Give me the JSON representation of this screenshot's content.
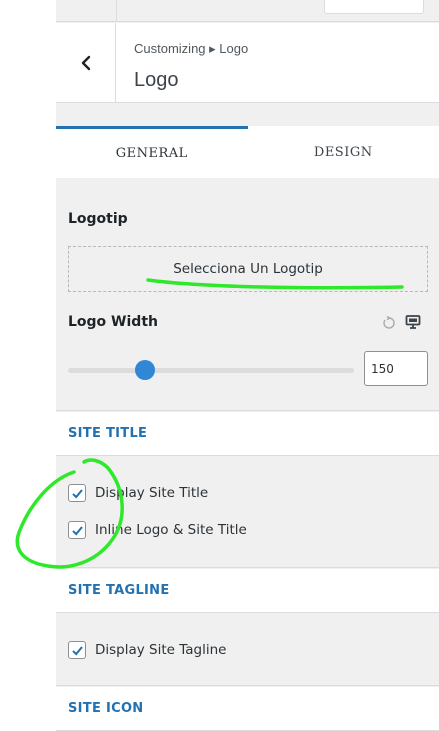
{
  "header": {
    "breadcrumb": "Customizing ▸ Logo",
    "title": "Logo"
  },
  "tabs": [
    {
      "label": "GENERAL",
      "active": true
    },
    {
      "label": "DESIGN",
      "active": false
    }
  ],
  "general": {
    "logo_label": "Logotip",
    "logo_button": "Selecciona Un Logotip",
    "width_label": "Logo Width",
    "width_value": "150",
    "width_fraction": 0.27
  },
  "site_title": {
    "heading": "SITE TITLE",
    "options": [
      {
        "label": "Display Site Title",
        "checked": true
      },
      {
        "label": "Inline Logo & Site Title",
        "checked": true
      }
    ]
  },
  "site_tagline": {
    "heading": "SITE TAGLINE",
    "options": [
      {
        "label": "Display Site Tagline",
        "checked": true
      }
    ]
  },
  "site_icon": {
    "heading": "SITE ICON"
  },
  "icons": {
    "back": "chevron-left-icon",
    "reset": "reset-icon",
    "device": "desktop-icon",
    "check": "checkmark-icon"
  },
  "colors": {
    "accent": "#2271b1",
    "slider_thumb": "#2f87d6",
    "annotation": "#2ee82a",
    "panel_bg": "#f0f0f0"
  }
}
